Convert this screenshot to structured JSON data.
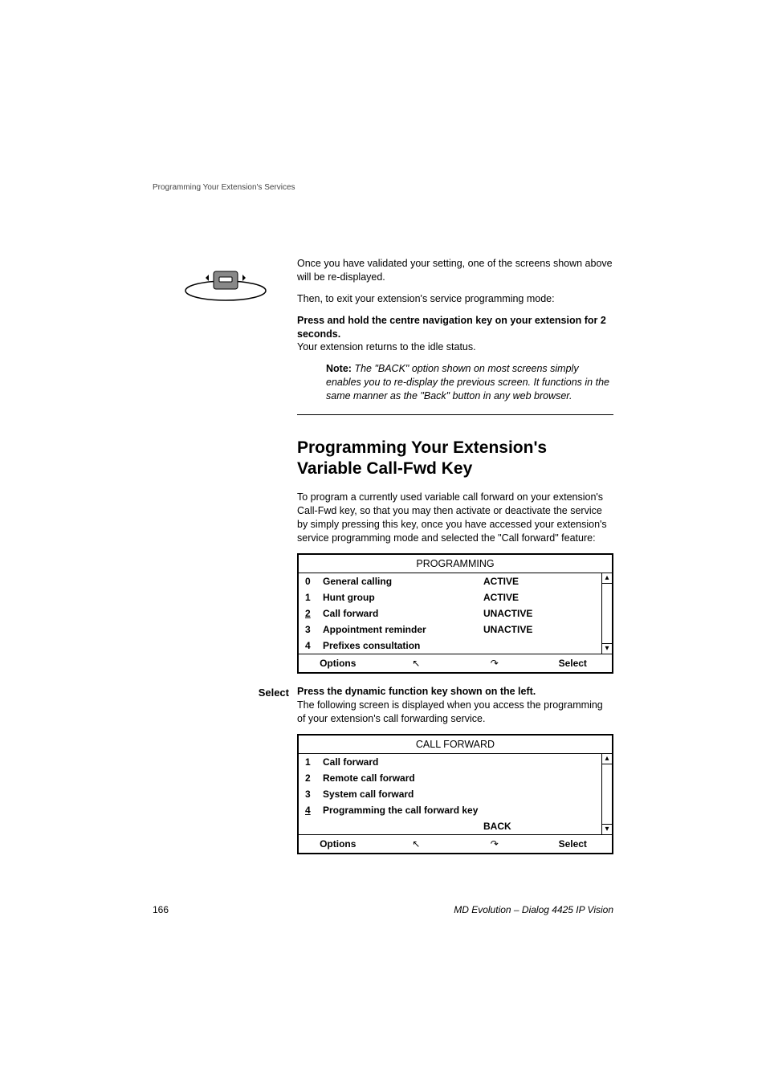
{
  "running_header": "Programming Your Extension's Services",
  "intro": {
    "p1": "Once you have validated your setting, one of the screens shown above will be re-displayed.",
    "p2": "Then, to exit your extension's service programming mode:",
    "instr_bold": "Press and hold the centre navigation key on your extension for 2 seconds.",
    "instr_rest": "Your extension returns to the idle status.",
    "note_label": "Note:",
    "note_text": "The \"BACK\" option shown on most screens simply enables you to re-display the previous screen. It functions in the same manner as the \"Back\" button in any web browser."
  },
  "section_title": "Programming Your Extension's Variable Call-Fwd Key",
  "section_para": "To program a currently used variable call forward on your extension's Call-Fwd key, so that you may then activate or deactivate the service by simply pressing this key, once you have accessed your extension's service programming mode and selected the \"Call forward\" feature:",
  "screen1": {
    "title": "PROGRAMMING",
    "rows": [
      {
        "num": "0",
        "label": "General calling",
        "status": "ACTIVE"
      },
      {
        "num": "1",
        "label": "Hunt group",
        "status": "ACTIVE"
      },
      {
        "num": "2",
        "label": "Call forward",
        "status": "UNACTIVE"
      },
      {
        "num": "3",
        "label": "Appointment reminder",
        "status": "UNACTIVE"
      },
      {
        "num": "4",
        "label": "Prefixes consultation",
        "status": ""
      }
    ],
    "softkeys": {
      "k1": "Options",
      "k2": "↖",
      "k3": "↷",
      "k4": "Select"
    }
  },
  "select_label": "Select",
  "select_instr_bold": "Press the dynamic function key shown on the left.",
  "select_instr_rest": "The following screen is displayed when you access the programming of your extension's call forwarding service.",
  "screen2": {
    "title": "CALL FORWARD",
    "rows": [
      {
        "num": "1",
        "label": "Call forward"
      },
      {
        "num": "2",
        "label": "Remote call forward"
      },
      {
        "num": "3",
        "label": "System call forward"
      },
      {
        "num": "4",
        "label": "Programming the call forward key"
      }
    ],
    "back_label": "BACK",
    "softkeys": {
      "k1": "Options",
      "k2": "↖",
      "k3": "↷",
      "k4": "Select"
    }
  },
  "footer": {
    "page": "166",
    "doc": "MD Evolution – Dialog 4425 IP Vision"
  }
}
